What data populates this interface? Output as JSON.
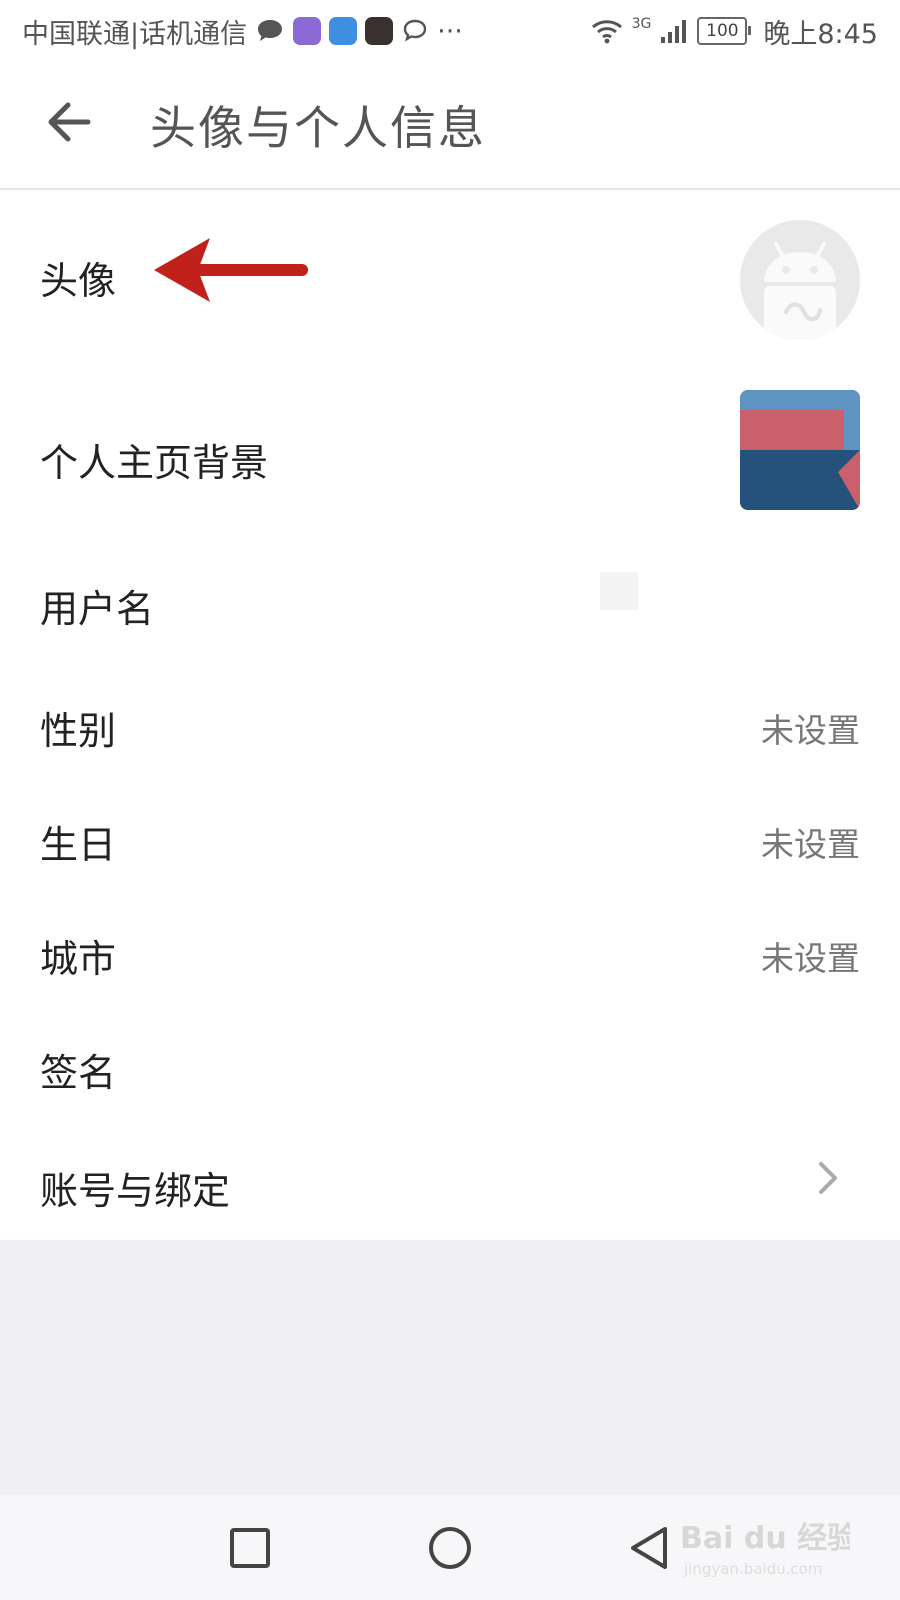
{
  "status_bar": {
    "carrier": "中国联通|话机通信",
    "network": "3G",
    "battery": "100",
    "time": "晚上8:45",
    "overflow": "···"
  },
  "header": {
    "title": "头像与个人信息",
    "back_icon": "arrow-left-icon"
  },
  "rows": {
    "avatar": {
      "label": "头像"
    },
    "background": {
      "label": "个人主页背景"
    },
    "username": {
      "label": "用户名"
    },
    "gender": {
      "label": "性别",
      "value": "未设置"
    },
    "birthday": {
      "label": "生日",
      "value": "未设置"
    },
    "city": {
      "label": "城市",
      "value": "未设置"
    },
    "signature": {
      "label": "签名"
    },
    "account": {
      "label": "账号与绑定",
      "icon": "chevron-right-icon"
    }
  },
  "nav_bar": {
    "icons": [
      "square-recent-icon",
      "circle-home-icon",
      "triangle-back-icon"
    ]
  },
  "watermark": {
    "brand": "Bai du 经验",
    "url": "jingyan.baidu.com"
  },
  "colors": {
    "annotation_arrow": "#c0211b",
    "list_background": "#ffffff",
    "empty_area": "#f0f0f4",
    "secondary_text": "#777777"
  }
}
